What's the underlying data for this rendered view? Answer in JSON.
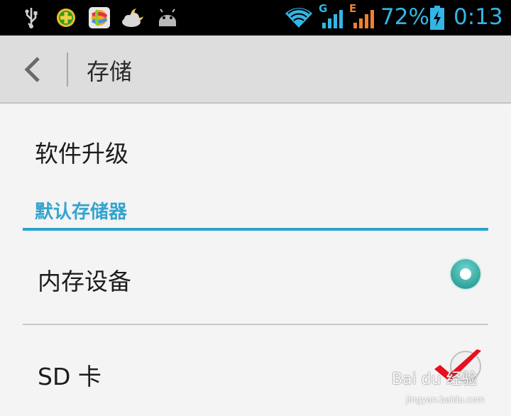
{
  "status_bar": {
    "icons": [
      "usb-icon",
      "app-plus-icon",
      "app-ball-icon",
      "weather-icon",
      "android-icon",
      "wifi-icon",
      "signal-g-icon",
      "signal-e-icon",
      "battery-charging-icon"
    ],
    "network_g": "G",
    "network_e": "E",
    "battery_percent": "72%",
    "battery_level": 0.72,
    "time": "0:13",
    "accent_color": "#33b5e5"
  },
  "action_bar": {
    "back_icon": "chevron-left-icon",
    "title": "存储"
  },
  "settings": {
    "upgrade_label": "软件升级",
    "section_header": "默认存储器",
    "options": [
      {
        "label": "内存设备",
        "selected": true
      },
      {
        "label": "SD 卡",
        "selected": false
      }
    ]
  },
  "watermark": {
    "text": "Bai du 经验",
    "url": "jingyan.baidu.com"
  },
  "colors": {
    "accent": "#33a4cf",
    "radio_selected": "#3bb8b0",
    "check_mark": "#e8101e"
  }
}
